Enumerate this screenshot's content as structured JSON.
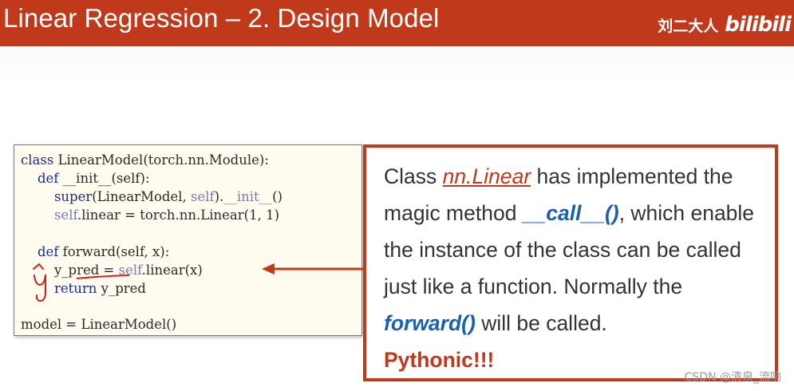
{
  "header": {
    "title": "Linear Regression – 2. Design Model",
    "author": "刘二大人",
    "logo_text": "bilibili"
  },
  "code": {
    "line1_a": "class",
    "line1_b": " LinearModel(torch.nn.Module):",
    "line2_a": "    def",
    "line2_b": " __init__(self):",
    "line3_a": "        super",
    "line3_b": "(LinearModel, ",
    "line3_c": "self",
    "line3_d": ").",
    "line3_e": "__init__",
    "line3_f": "()",
    "line4_a": "        self",
    "line4_b": ".linear = torch.nn.Linear(1, 1)",
    "line5_a": "    def",
    "line5_b": " forward(self, x):",
    "line6_a": "        y_pred",
    "line6_b": " = ",
    "line6_c": "self",
    "line6_d": ".linear(x)",
    "line7_a": "        return",
    "line7_b": " y_pred",
    "line8": "model = LinearModel()"
  },
  "annotation": {
    "handwritten": "ŷ"
  },
  "callout": {
    "l1_a": "Class ",
    "l1_b": "nn.Linear",
    "l1_c": " has implemented the",
    "l2_a": "magic method ",
    "l2_b": "__call__()",
    "l2_c": ", which enable",
    "l3": "the instance of the class can be called",
    "l4": "just like a function. Normally the",
    "l5_a": "forward()",
    "l5_b": " will be called.",
    "l6": "Pythonic!!!"
  },
  "watermark": "CSDN @清泉_流响",
  "colors": {
    "accent": "#c0391b",
    "keyword_blue": "#1a5fb4",
    "code_background": "#fffbee"
  }
}
